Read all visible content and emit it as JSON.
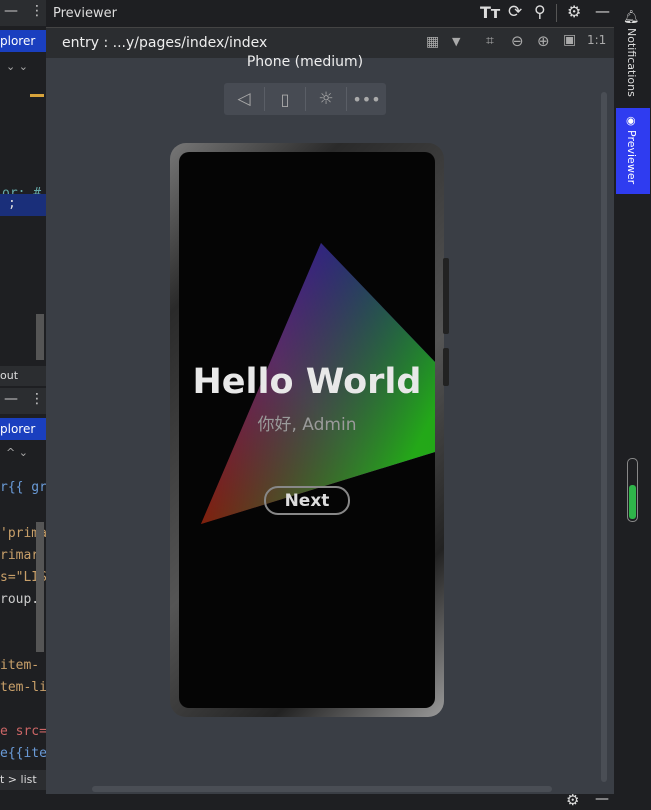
{
  "left_panel": {
    "tab_top": "plorer",
    "tab_bottom": "plorer",
    "section_label": "out",
    "code_lines_top": [
      "",
      "",
      "",
      "or: #",
      "",
      "",
      ";",
      "",
      "",
      ""
    ],
    "code_lines_bottom": [
      "r{{ gro",
      "",
      "'prima",
      "rimar",
      "s=\"LIS",
      "roup.",
      "",
      "",
      "item-",
      "tem-li",
      "",
      "e src=",
      "e{{ite",
      "t > list"
    ]
  },
  "previewer": {
    "title": "Previewer",
    "path": "entry : ...y/pages/index/index",
    "device_label": "Phone (medium)",
    "screen": {
      "heading": "Hello World",
      "subheading": "你好, Admin",
      "button": "Next"
    }
  },
  "right_sidebar": {
    "notifications": "Notifications",
    "previewer": "Previewer"
  },
  "colors": {
    "accent": "#2f3cf0",
    "panel": "#3a3e45",
    "dark": "#1e1f22"
  }
}
